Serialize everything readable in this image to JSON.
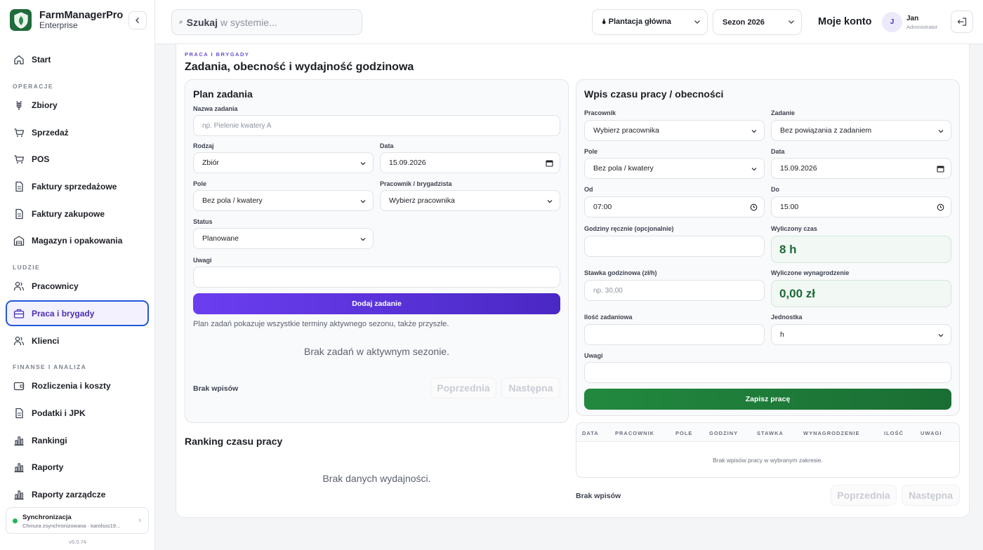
{
  "app": {
    "name": "FarmManagerPro",
    "edition": "Enterprise",
    "version": "v5.0.74"
  },
  "sidebar": {
    "items": [
      {
        "label": "Start",
        "icon": "home-icon"
      },
      {
        "label": "Zbiory",
        "icon": "wheat-icon"
      },
      {
        "label": "Sprzedaż",
        "icon": "cart-icon"
      },
      {
        "label": "POS",
        "icon": "cart-icon"
      },
      {
        "label": "Faktury sprzedażowe",
        "icon": "document-icon"
      },
      {
        "label": "Faktury zakupowe",
        "icon": "document-icon"
      },
      {
        "label": "Magazyn i opakowania",
        "icon": "warehouse-icon"
      },
      {
        "label": "Pracownicy",
        "icon": "users-icon"
      },
      {
        "label": "Praca i brygady",
        "icon": "briefcase-icon",
        "active": true
      },
      {
        "label": "Klienci",
        "icon": "users-icon"
      },
      {
        "label": "Rozliczenia i koszty",
        "icon": "wallet-icon"
      },
      {
        "label": "Podatki i JPK",
        "icon": "document-icon"
      },
      {
        "label": "Rankingi",
        "icon": "bar-chart-icon"
      },
      {
        "label": "Raporty",
        "icon": "bar-chart-icon"
      },
      {
        "label": "Raporty zarządcze",
        "icon": "bar-chart-icon"
      }
    ],
    "sections": {
      "operations": "OPERACJE",
      "people": "LUDZIE",
      "finance": "FINANSE I ANALIZA"
    },
    "sync": {
      "title": "Synchronizacja",
      "subtitle": "Chmura zsynchronizowana · karolsss19..."
    }
  },
  "topbar": {
    "search_icon": "⌕",
    "search_bold": "Szukaj",
    "search_rest": "w systemie...",
    "plantation": "🌢 Plantacja główna",
    "season": "Sezon 2026",
    "account_label": "Moje konto",
    "avatar_initial": "J",
    "user_name": "Jan",
    "user_role": "Administrator"
  },
  "page": {
    "eyebrow": "PRACA I BRYGADY",
    "title": "Zadania, obecność i wydajność godzinowa"
  },
  "plan": {
    "title": "Plan zadania",
    "name_label": "Nazwa zadania",
    "name_placeholder": "np. Pielenie kwatery A",
    "type_label": "Rodzaj",
    "type_value": "Zbiór",
    "date_label": "Data",
    "date_value": "15.09.2026",
    "field_label": "Pole",
    "field_value": "Bez pola / kwatery",
    "worker_label": "Pracownik / brygadzista",
    "worker_value": "Wybierz pracownika",
    "status_label": "Status",
    "status_value": "Planowane",
    "notes_label": "Uwagi",
    "notes_value": "",
    "add_button": "Dodaj zadanie",
    "info": "Plan zadań pokazuje wszystkie terminy aktywnego sezonu, także przyszłe.",
    "empty": "Brak zadań w aktywnym sezonie.",
    "no_entries": "Brak wpisów",
    "prev": "Poprzednia",
    "next": "Następna"
  },
  "work": {
    "title": "Wpis czasu pracy / obecności",
    "worker_label": "Pracownik",
    "worker_value": "Wybierz pracownika",
    "task_label": "Zadanie",
    "task_value": "Bez powiązania z zadaniem",
    "field_label": "Pole",
    "field_value": "Bez pola / kwatery",
    "date_label": "Data",
    "date_value": "15.09.2026",
    "from_label": "Od",
    "from_value": "07:00",
    "to_label": "Do",
    "to_value": "15:00",
    "manual_hours_label": "Godziny ręcznie (opcjonalnie)",
    "manual_hours_value": "",
    "calc_time_label": "Wyliczony czas",
    "calc_time_value": "8 h",
    "rate_label": "Stawka godzinowa (zł/h)",
    "rate_placeholder": "np. 30,00",
    "calc_pay_label": "Wyliczone wynagrodzenie",
    "calc_pay_value": "0,00 zł",
    "qty_label": "Ilość zadaniowa",
    "qty_value": "",
    "unit_label": "Jednostka",
    "unit_value": "h",
    "notes_label": "Uwagi",
    "notes_value": "",
    "save_button": "Zapisz pracę"
  },
  "ranking": {
    "title": "Ranking czasu pracy",
    "empty": "Brak danych wydajności."
  },
  "table": {
    "columns": [
      "DATA",
      "PRACOWNIK",
      "POLE",
      "GODZINY",
      "STAWKA",
      "WYNAGRODZENIE",
      "ILOŚĆ",
      "UWAGI"
    ],
    "empty": "Brak wpisów pracy w wybranym zakresie.",
    "no_entries": "Brak wpisów",
    "prev": "Poprzednia",
    "next": "Następna"
  },
  "colors": {
    "accent": "#5b35e0",
    "success": "#1d6b37",
    "active_border": "#2458d8"
  }
}
